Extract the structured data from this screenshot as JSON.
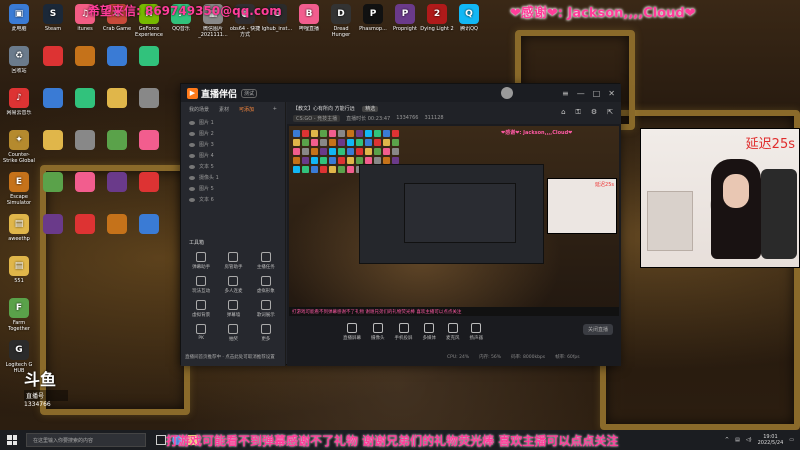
{
  "overlay": {
    "top_contact": "希望来信: 869749350@qq.com",
    "top_thanks": "❤感谢❤: Jackson,,,,Cloud❤",
    "bottom_banner": "打游戏可能看不到弹幕感谢不了礼物  谢谢兄弟们的礼物荧光棒  喜欢主播可以点点关注",
    "delay_label": "延迟25s",
    "douyu_logo_text": "斗鱼",
    "douyu_room_label": "直播号",
    "douyu_room_number": "1334766"
  },
  "desktop_icons": [
    {
      "label": "此电脑",
      "icon": "computer-icon",
      "color": "#3a7bd5",
      "glyph": "▣"
    },
    {
      "label": "回收站",
      "icon": "recycle-bin-icon",
      "color": "#6b7b8c",
      "glyph": "♻"
    },
    {
      "label": "网易云音乐",
      "icon": "netease-music-icon",
      "color": "#d33",
      "glyph": "♪"
    },
    {
      "label": "Counter-Strike Global Of...",
      "icon": "csgo-icon",
      "color": "#b58a2e",
      "glyph": "✦"
    },
    {
      "label": "Escape Simulator",
      "icon": "escape-sim-icon",
      "color": "#c5721a",
      "glyph": "E"
    },
    {
      "label": "aweethp",
      "icon": "folder-icon",
      "color": "#e0b64a",
      "glyph": "▤"
    },
    {
      "label": "551",
      "icon": "folder-icon",
      "color": "#e0b64a",
      "glyph": "▤"
    },
    {
      "label": "Farm Together",
      "icon": "farm-together-icon",
      "color": "#5aa24a",
      "glyph": "F"
    },
    {
      "label": "Logitech G HUB",
      "icon": "logitech-icon",
      "color": "#2b2b2b",
      "glyph": "G"
    },
    {
      "label": "Steam",
      "icon": "steam-icon",
      "color": "#1b2838",
      "glyph": "S"
    },
    {
      "label": "itunes",
      "icon": "itunes-icon",
      "color": "#f25c84",
      "glyph": "♫"
    },
    {
      "label": "Crab Game",
      "icon": "crab-game-icon",
      "color": "#c84a3a",
      "glyph": "C"
    },
    {
      "label": "GeForce Experience",
      "icon": "geforce-icon",
      "color": "#76b900",
      "glyph": "N"
    },
    {
      "label": "QQ音乐",
      "icon": "qq-music-icon",
      "color": "#31c27c",
      "glyph": "♪"
    },
    {
      "label": "微信图片_2021111...",
      "icon": "image-file-icon",
      "color": "#888",
      "glyph": "▦"
    },
    {
      "label": "obs64 - 快捷方式",
      "icon": "obs-icon",
      "color": "#302e31",
      "glyph": "●"
    },
    {
      "label": "lghub_inst...",
      "icon": "installer-icon",
      "color": "#2b2b2b",
      "glyph": "G"
    },
    {
      "label": "哔哩直播",
      "icon": "bilibili-icon",
      "color": "#f25d8e",
      "glyph": "B"
    },
    {
      "label": "Dread Hunger",
      "icon": "dread-hunger-icon",
      "color": "#333",
      "glyph": "D"
    },
    {
      "label": "Phasmop...",
      "icon": "phasmophobia-icon",
      "color": "#111",
      "glyph": "P"
    },
    {
      "label": "Propnight",
      "icon": "propnight-icon",
      "color": "#6a3a8a",
      "glyph": "P"
    },
    {
      "label": "Dying Light 2",
      "icon": "dying-light-icon",
      "color": "#b01a1a",
      "glyph": "2"
    },
    {
      "label": "腾讯QQ",
      "icon": "qq-icon",
      "color": "#12b7f5",
      "glyph": "Q"
    }
  ],
  "app": {
    "title": "直播伴侣",
    "beta": "测试",
    "left_tabs": [
      "我的场景",
      "素材",
      "可添加"
    ],
    "active_tab": 2,
    "scenes": [
      "图片 1",
      "图片 2",
      "图片 3",
      "图片 4",
      "文本 5",
      "摄像头 1",
      "图片 5",
      "文本 6"
    ],
    "tools_label": "工具箱",
    "tools": [
      "弹幕助手",
      "房管助手",
      "主播任务",
      "玩法互动",
      "多人连麦",
      "虚拟形象",
      "虚拟背景",
      "弹幕墙",
      "歌词展示",
      "PK",
      "抽奖",
      "更多"
    ],
    "stream_title": "【教文】心有所向 方能行远",
    "stream_tag": "精选",
    "stream_category": "CS:GO - 竞技主播",
    "stream_meta": [
      "直播时长 00:23:47",
      "1334766",
      "311128"
    ],
    "preview_thanks": "❤感谢❤: Jackson,,,,Cloud❤",
    "preview_banner": "打游戏可能看不到弹幕感谢不了礼物 谢谢兄弟们的礼物荧光棒 喜欢主播可以点点关注",
    "controls": [
      "直播屏幕",
      "摄像头",
      "手机投屏",
      "多媒体",
      "麦克风",
      "扬声器"
    ],
    "start_button": "关闭直播",
    "status": [
      "CPU: 24%",
      "内存: 56%",
      "码率: 8000kbps",
      "帧率: 60fps"
    ],
    "left_notice": "直播间首页推荐中 · 点击此处可取消推荐设置"
  },
  "taskbar": {
    "search_placeholder": "在这里输入你要搜索的内容",
    "time": "19:01",
    "date": "2022/5/24"
  }
}
